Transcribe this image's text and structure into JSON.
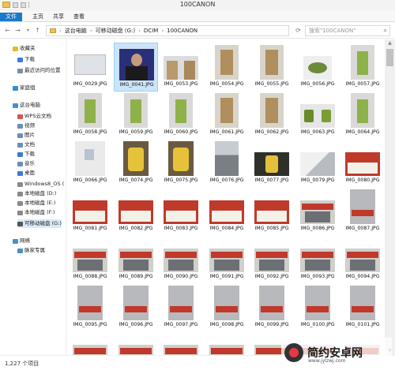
{
  "window": {
    "title": "100CANON"
  },
  "ribbon": {
    "tabs": [
      "文件",
      "主页",
      "共享",
      "查看"
    ]
  },
  "address": {
    "crumbs": [
      "这台电脑",
      "可移动磁盘 (G:)",
      "DCIM",
      "100CANON"
    ],
    "search_placeholder": "搜索\"100CANON\""
  },
  "nav": {
    "items": [
      {
        "label": "收藏夹",
        "icon": "star-icon",
        "color": "#e8b730"
      },
      {
        "label": "下载",
        "icon": "download-icon",
        "color": "#3a7bd5"
      },
      {
        "label": "最近访问的位置",
        "icon": "recent-icon",
        "color": "#7a8da6"
      },
      {
        "label": "家庭组",
        "icon": "homegroup-icon",
        "color": "#2c8fd6"
      },
      {
        "label": "这台电脑",
        "icon": "computer-icon",
        "color": "#4a90c8"
      },
      {
        "label": "WPS云文档",
        "icon": "cloud-icon",
        "color": "#d9534f"
      },
      {
        "label": "视频",
        "icon": "video-icon",
        "color": "#6b8fb7"
      },
      {
        "label": "图片",
        "icon": "picture-icon",
        "color": "#6b8fb7"
      },
      {
        "label": "文档",
        "icon": "document-icon",
        "color": "#6b8fb7"
      },
      {
        "label": "下载",
        "icon": "download-icon",
        "color": "#3a7bd5"
      },
      {
        "label": "音乐",
        "icon": "music-icon",
        "color": "#6b8fb7"
      },
      {
        "label": "桌面",
        "icon": "desktop-icon",
        "color": "#3a7bd5"
      },
      {
        "label": "Windows8_OS (",
        "icon": "drive-icon",
        "color": "#8a8a8a"
      },
      {
        "label": "本地磁盘 (D:)",
        "icon": "drive-icon",
        "color": "#8a8a8a"
      },
      {
        "label": "本地磁盘 (E:)",
        "icon": "drive-icon",
        "color": "#8a8a8a"
      },
      {
        "label": "本地磁盘 (F:)",
        "icon": "drive-icon",
        "color": "#8a8a8a"
      },
      {
        "label": "可移动磁盘 (G:)",
        "icon": "usb-drive-icon",
        "color": "#555555"
      },
      {
        "label": "网络",
        "icon": "network-icon",
        "color": "#4a90c8"
      },
      {
        "label": "脉家专属",
        "icon": "network-computer-icon",
        "color": "#4a90c8"
      }
    ]
  },
  "files": [
    {
      "name": "IMG_0029.JPG",
      "kind": "doc"
    },
    {
      "name": "IMG_0041.JPG",
      "kind": "portrait"
    },
    {
      "name": "IMG_0053.JPG",
      "kind": "twobags"
    },
    {
      "name": "IMG_0054.JPG",
      "kind": "bag"
    },
    {
      "name": "IMG_0055.JPG",
      "kind": "bag"
    },
    {
      "name": "IMG_0056.JPG",
      "kind": "tea"
    },
    {
      "name": "IMG_0057.JPG",
      "kind": "box"
    },
    {
      "name": "IMG_0058.JPG",
      "kind": "box"
    },
    {
      "name": "IMG_0059.JPG",
      "kind": "box"
    },
    {
      "name": "IMG_0060.JPG",
      "kind": "box"
    },
    {
      "name": "IMG_0061.JPG",
      "kind": "bag"
    },
    {
      "name": "IMG_0062.JPG",
      "kind": "bag"
    },
    {
      "name": "IMG_0063.JPG",
      "kind": "cups"
    },
    {
      "name": "IMG_0064.JPG",
      "kind": "box"
    },
    {
      "name": "IMG_0066.JPG",
      "kind": "wall"
    },
    {
      "name": "IMG_0074.JPG",
      "kind": "jar"
    },
    {
      "name": "IMG_0075.JPG",
      "kind": "jar"
    },
    {
      "name": "IMG_0076.JPG",
      "kind": "city"
    },
    {
      "name": "IMG_0077.JPG",
      "kind": "jarsmall"
    },
    {
      "name": "IMG_0079.JPG",
      "kind": "paper"
    },
    {
      "name": "IMG_0080.JPG",
      "kind": "banner"
    },
    {
      "name": "IMG_0081.JPG",
      "kind": "banner"
    },
    {
      "name": "IMG_0082.JPG",
      "kind": "banner"
    },
    {
      "name": "IMG_0083.JPG",
      "kind": "banner"
    },
    {
      "name": "IMG_0084.JPG",
      "kind": "banner"
    },
    {
      "name": "IMG_0085.JPG",
      "kind": "banner"
    },
    {
      "name": "IMG_0086.JPG",
      "kind": "store"
    },
    {
      "name": "IMG_0087.JPG",
      "kind": "building"
    },
    {
      "name": "IMG_0088.JPG",
      "kind": "store"
    },
    {
      "name": "IMG_0089.JPG",
      "kind": "store"
    },
    {
      "name": "IMG_0090.JPG",
      "kind": "store"
    },
    {
      "name": "IMG_0091.JPG",
      "kind": "store"
    },
    {
      "name": "IMG_0092.JPG",
      "kind": "store"
    },
    {
      "name": "IMG_0093.JPG",
      "kind": "store"
    },
    {
      "name": "IMG_0094.JPG",
      "kind": "store"
    },
    {
      "name": "IMG_0095.JPG",
      "kind": "building"
    },
    {
      "name": "IMG_0096.JPG",
      "kind": "building"
    },
    {
      "name": "IMG_0097.JPG",
      "kind": "building"
    },
    {
      "name": "IMG_0098.JPG",
      "kind": "building"
    },
    {
      "name": "IMG_0099.JPG",
      "kind": "building"
    },
    {
      "name": "IMG_0100.JPG",
      "kind": "building"
    },
    {
      "name": "IMG_0101.JPG",
      "kind": "building"
    },
    {
      "name": "",
      "kind": "store"
    },
    {
      "name": "",
      "kind": "store"
    },
    {
      "name": "",
      "kind": "store"
    },
    {
      "name": "",
      "kind": "store"
    },
    {
      "name": "",
      "kind": "store"
    },
    {
      "name": "",
      "kind": "store"
    },
    {
      "name": "",
      "kind": "store"
    }
  ],
  "selected_file": "IMG_0041.JPG",
  "status": {
    "count": "1,227 个项目"
  },
  "watermark": {
    "text": "简约安卓网",
    "url": "www.jylzwj.com"
  }
}
